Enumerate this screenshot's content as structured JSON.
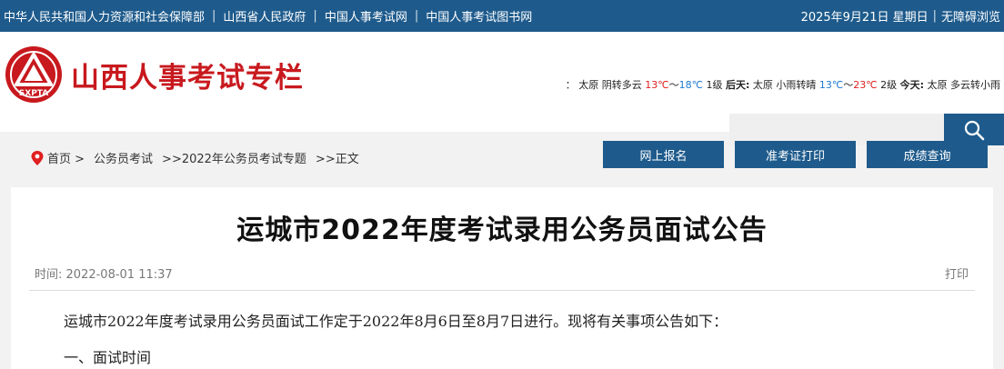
{
  "topbar": {
    "links": [
      "中华人民共和国人力资源和社会保障部",
      "山西省人民政府",
      "中国人事考试网",
      "中国人事考试图书网"
    ],
    "date": "2025年9月21日 星期日",
    "accessibility": "无障碍浏览"
  },
  "header": {
    "logo_text": "SXPTA",
    "site_title": "山西人事考试专栏",
    "weather": {
      "lead": "：",
      "city1": "太原",
      "cond1": "阴转多云",
      "t1_high": "13℃",
      "tilde1": "～",
      "t1_low": "18℃",
      "wind1": "1级",
      "label2": "后天:",
      "city2": "太原",
      "cond2": "小雨转晴",
      "t2_low": "13℃",
      "tilde2": "～",
      "t2_high": "23℃",
      "wind2": "2级",
      "label3": "今天:",
      "city3": "太原",
      "cond3": "多云转小雨"
    },
    "search_placeholder": ""
  },
  "breadcrumb": {
    "home": "首页 >",
    "level1": "公务员考试",
    "level2": ">>2022年公务员考试专题",
    "level3": ">>正文"
  },
  "buttons": {
    "register": "网上报名",
    "admit": "准考证打印",
    "score": "成绩查询"
  },
  "article": {
    "title": "运城市2022年度考试录用公务员面试公告",
    "time_label": "时间:",
    "time_value": "2022-08-01 11:37",
    "print": "打印",
    "para1": "运城市2022年度考试录用公务员面试工作定于2022年8月6日至8月7日进行。现将有关事项公告如下：",
    "section1": "一、面试时间"
  },
  "colors": {
    "primary": "#1e5b8c",
    "logo_red": "#c8191e",
    "temp_red": "#e02020",
    "temp_blue": "#1e7ad4"
  }
}
